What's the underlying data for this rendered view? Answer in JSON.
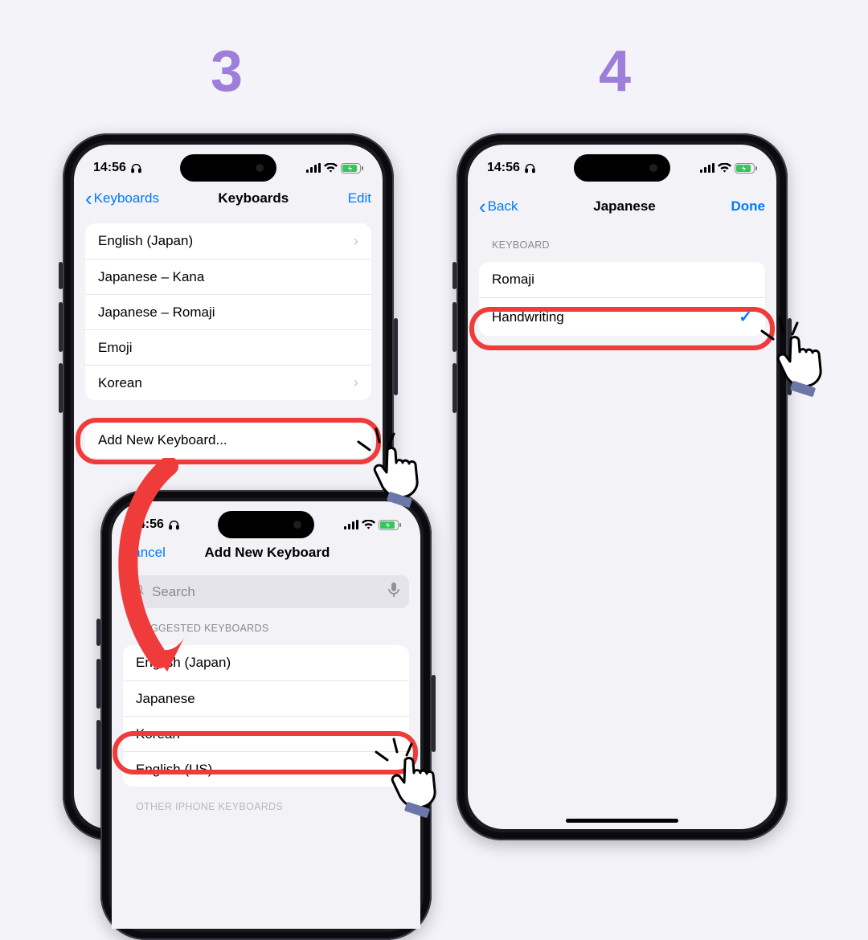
{
  "steps": {
    "three": "3",
    "four": "4"
  },
  "status": {
    "time": "14:56"
  },
  "phoneA": {
    "nav": {
      "back": "Keyboards",
      "title": "Keyboards",
      "right": "Edit"
    },
    "list": {
      "r0": "English (Japan)",
      "r1": "Japanese – Kana",
      "r2": "Japanese – Romaji",
      "r3": "Emoji",
      "r4": "Korean"
    },
    "add": "Add New Keyboard..."
  },
  "phoneB": {
    "nav": {
      "left": "Cancel",
      "title": "Add New Keyboard"
    },
    "search_placeholder": "Search",
    "section_suggested": "SUGGESTED KEYBOARDS",
    "list": {
      "r0": "English (Japan)",
      "r1": "Japanese",
      "r2": "Korean",
      "r3": "English (US)"
    },
    "section_other": "OTHER IPHONE KEYBOARDS"
  },
  "phoneC": {
    "nav": {
      "back": "Back",
      "title": "Japanese",
      "right": "Done"
    },
    "section": "KEYBOARD",
    "list": {
      "r0": "Romaji",
      "r1": "Handwriting"
    }
  }
}
